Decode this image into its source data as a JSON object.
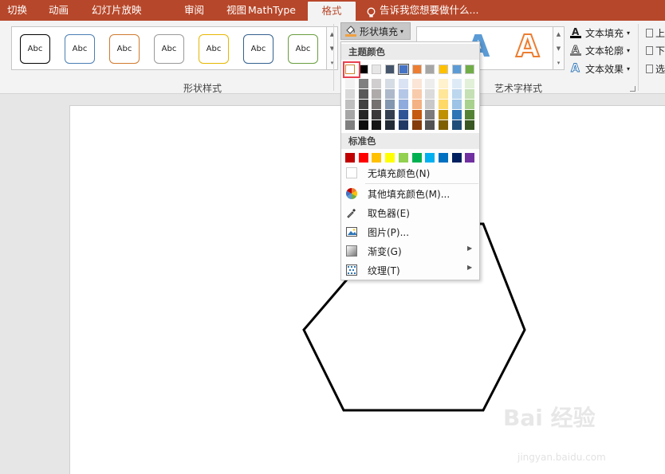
{
  "tabs": {
    "transitions": "切换",
    "animations": "动画",
    "slideshow": "幻灯片放映",
    "review": "审阅",
    "view": "视图",
    "mathtype": "MathType",
    "format": "格式",
    "tell_me": "告诉我您想要做什么..."
  },
  "ribbon": {
    "shape_styles": {
      "label": "形状样式",
      "items": [
        {
          "text": "Abc",
          "color": "#000000"
        },
        {
          "text": "Abc",
          "color": "#4a7eb3"
        },
        {
          "text": "Abc",
          "color": "#d07a2e"
        },
        {
          "text": "Abc",
          "color": "#9a9a9a"
        },
        {
          "text": "Abc",
          "color": "#e6b800"
        },
        {
          "text": "Abc",
          "color": "#33608e"
        },
        {
          "text": "Abc",
          "color": "#6a9e3f"
        }
      ],
      "shape_fill_label": "形状填充"
    },
    "wordart_styles": {
      "label": "艺术字样式",
      "letters": [
        "A",
        "A"
      ],
      "text_fill_label": "文本填充",
      "text_outline_label": "文本轮廓",
      "text_effects_label": "文本效果"
    },
    "right_cut": [
      "上",
      "下",
      "选"
    ]
  },
  "fill_menu": {
    "theme_colors_label": "主题颜色",
    "theme_top_row": [
      "#ffffff",
      "#000000",
      "#e7e6e6",
      "#44546a",
      "#4472c4",
      "#ed7d31",
      "#a5a5a5",
      "#ffc000",
      "#5b9bd5",
      "#70ad47"
    ],
    "theme_shades": [
      [
        "#f2f2f2",
        "#7f7f7f",
        "#d0cece",
        "#d6dce4",
        "#dae3f3",
        "#fbe5d6",
        "#ededed",
        "#fff2cc",
        "#deebf7",
        "#e2f0d9"
      ],
      [
        "#d9d9d9",
        "#595959",
        "#aeaaaa",
        "#adb9ca",
        "#b4c7e7",
        "#f8cbad",
        "#dbdbdb",
        "#ffe699",
        "#bdd7ee",
        "#c5e0b4"
      ],
      [
        "#bfbfbf",
        "#404040",
        "#757171",
        "#8497b0",
        "#8faadc",
        "#f4b183",
        "#c9c9c9",
        "#ffd966",
        "#9dc3e6",
        "#a9d18e"
      ],
      [
        "#a6a6a6",
        "#262626",
        "#3a3838",
        "#333f50",
        "#2f5597",
        "#c55a11",
        "#7b7b7b",
        "#bf9000",
        "#2e75b6",
        "#548235"
      ],
      [
        "#7f7f7f",
        "#0d0d0d",
        "#171616",
        "#222a35",
        "#203864",
        "#843c0c",
        "#525252",
        "#7f6000",
        "#1f4e79",
        "#385723"
      ]
    ],
    "standard_colors_label": "标准色",
    "standard_colors": [
      "#c00000",
      "#ff0000",
      "#ffc000",
      "#ffff00",
      "#92d050",
      "#00b050",
      "#00b0f0",
      "#0070c0",
      "#002060",
      "#7030a0"
    ],
    "no_fill_label": "无填充颜色(N)",
    "more_colors_label": "其他填充颜色(M)...",
    "eyedropper_label": "取色器(E)",
    "picture_label": "图片(P)...",
    "gradient_label": "渐变(G)",
    "texture_label": "纹理(T)"
  },
  "watermark": {
    "main": "Bai 经验",
    "sub": "jingyan.baidu.com"
  }
}
